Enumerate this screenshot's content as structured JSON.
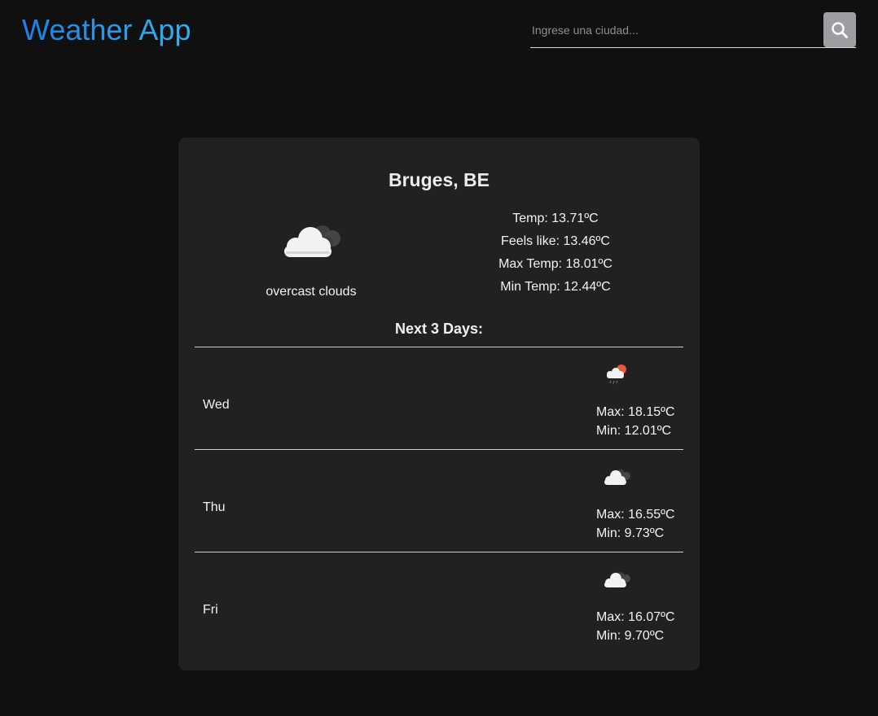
{
  "header": {
    "app_title": "Weather App",
    "search_placeholder": "Ingrese una ciudad...",
    "search_icon": "search-icon",
    "title_gradient": [
      "#1f7fe6",
      "#2fb2f0"
    ]
  },
  "current": {
    "city": "Bruges, BE",
    "icon": "overcast-clouds-icon",
    "description": "overcast clouds",
    "temp": "Temp: 13.71ºC",
    "feels_like": "Feels like: 13.46ºC",
    "max_temp": "Max Temp: 18.01ºC",
    "min_temp": "Min Temp: 12.44ºC"
  },
  "forecast": {
    "title": "Next 3 Days:",
    "days": [
      {
        "day": "Wed",
        "icon": "rain-sun-icon",
        "max": "Max: 18.15ºC",
        "min": "Min: 12.01ºC"
      },
      {
        "day": "Thu",
        "icon": "broken-clouds-icon",
        "max": "Max: 16.55ºC",
        "min": "Min: 9.73ºC"
      },
      {
        "day": "Fri",
        "icon": "broken-clouds-icon",
        "max": "Max: 16.07ºC",
        "min": "Min: 9.70ºC"
      }
    ]
  },
  "colors": {
    "background": "#101010",
    "card": "#212121",
    "search_button": "#9e9ea2",
    "sun_accent": "#e8583a"
  }
}
